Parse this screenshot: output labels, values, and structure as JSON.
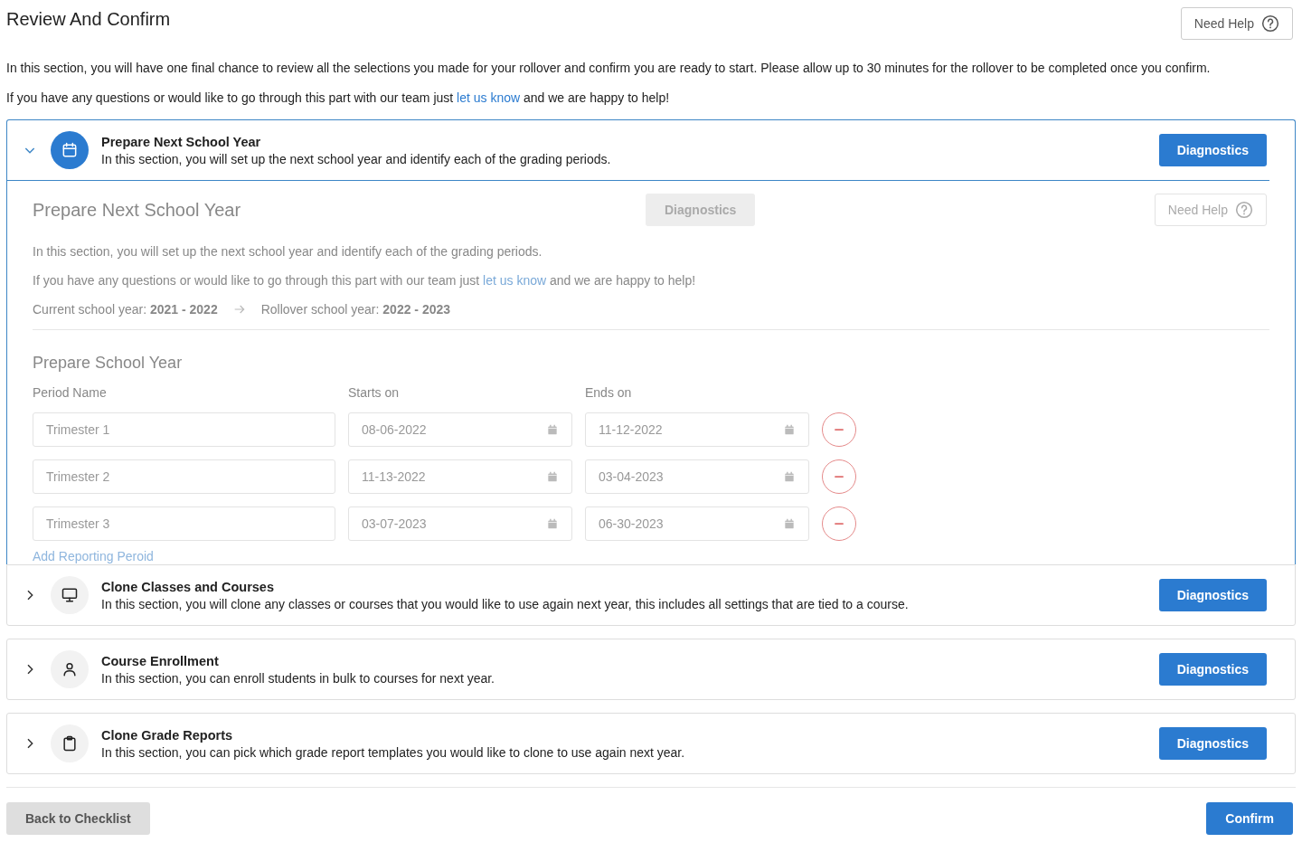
{
  "page": {
    "title": "Review And Confirm",
    "help_button": "Need Help",
    "intro": "In this section, you will have one final chance to review all the selections you made for your rollover and confirm you are ready to start. Please allow up to 30 minutes for the rollover to be completed once you confirm.",
    "contact": {
      "before": "If you have any questions or would like to go through this part with our team just ",
      "link": "let us know",
      "after": " and we are happy to help!"
    }
  },
  "sections": [
    {
      "kind": "calendar",
      "expanded": true,
      "title": "Prepare Next School Year",
      "description": "In this section, you will set up the next school year and identify each of the grading periods.",
      "button": "Diagnostics",
      "detail": {
        "title": "Prepare Next School Year",
        "diagnostics_button": {
          "label": "Diagnostics",
          "disabled": true
        },
        "help_button": "Need Help",
        "description": "In this section, you will set up the next school year and identify each of the grading periods.",
        "contact": {
          "before": "If you have any questions or would like to go through this part with our team just ",
          "link": "let us know",
          "after": " and we are happy to help!"
        },
        "current_label": "Current school year:",
        "current_value": "2021 - 2022",
        "rollover_label": "Rollover school year:",
        "rollover_value": "2022 - 2023",
        "subtitle": "Prepare School Year",
        "columns": [
          "Period Name",
          "Starts on",
          "Ends on"
        ],
        "periods": [
          {
            "name": "Trimester 1",
            "start": "08-06-2022",
            "end": "11-12-2022"
          },
          {
            "name": "Trimester 2",
            "start": "11-13-2022",
            "end": "03-04-2023"
          },
          {
            "name": "Trimester 3",
            "start": "03-07-2023",
            "end": "06-30-2023"
          }
        ],
        "add_link": "Add Reporting Peroid"
      }
    },
    {
      "kind": "monitor",
      "expanded": false,
      "title": "Clone Classes and Courses",
      "description": "In this section, you will clone any classes or courses that you would like to use again next year, this includes all settings that are tied to a course.",
      "button": "Diagnostics"
    },
    {
      "kind": "person",
      "expanded": false,
      "title": "Course Enrollment",
      "description": "In this section, you can enroll students in bulk to courses for next year.",
      "button": "Diagnostics"
    },
    {
      "kind": "clipboard",
      "expanded": false,
      "title": "Clone Grade Reports",
      "description": "In this section, you can pick which grade report templates you would like to clone to use again next year.",
      "button": "Diagnostics"
    }
  ],
  "footer": {
    "back_button": "Back to Checklist",
    "confirm_button": "Confirm"
  }
}
